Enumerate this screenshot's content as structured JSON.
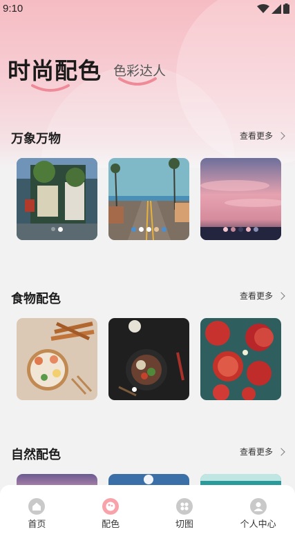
{
  "status_bar": {
    "time": "9:10"
  },
  "header": {
    "title": "时尚配色",
    "tab": "色彩达人"
  },
  "sections": [
    {
      "title": "万象万物",
      "more": "查看更多"
    },
    {
      "title": "食物配色",
      "more": "查看更多"
    },
    {
      "title": "自然配色",
      "more": "查看更多"
    }
  ],
  "bottom_nav": [
    {
      "label": "首页",
      "icon": "home-icon"
    },
    {
      "label": "配色",
      "icon": "palette-icon",
      "active": true
    },
    {
      "label": "切图",
      "icon": "grid-icon"
    },
    {
      "label": "个人中心",
      "icon": "user-icon"
    }
  ],
  "colors": {
    "accent": "#f7a3a9",
    "hero_bg": "#f6bcc3",
    "underline": "#ef8b98",
    "page_bg": "#f3f2f3"
  }
}
